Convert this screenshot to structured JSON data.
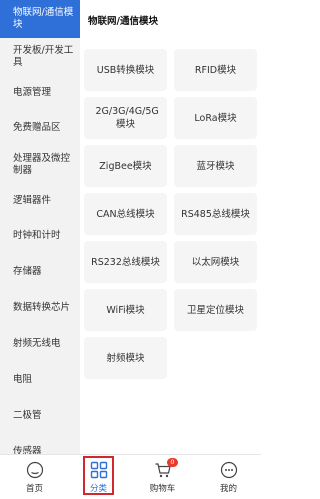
{
  "sidebar": {
    "items": [
      {
        "label": "物联网/通信模块",
        "active": true
      },
      {
        "label": "开发板/开发工具"
      },
      {
        "label": "电源管理"
      },
      {
        "label": "免费赠品区"
      },
      {
        "label": "处理器及微控制器"
      },
      {
        "label": "逻辑器件"
      },
      {
        "label": "时钟和计时"
      },
      {
        "label": "存储器"
      },
      {
        "label": "数据转换芯片"
      },
      {
        "label": "射频无线电"
      },
      {
        "label": "电阻"
      },
      {
        "label": "二极管"
      },
      {
        "label": "传感器"
      }
    ]
  },
  "content": {
    "title": "物联网/通信模块",
    "cards": [
      "USB转换模块",
      "RFID模块",
      "2G/3G/4G/5G模块",
      "LoRa模块",
      "ZigBee模块",
      "蓝牙模块",
      "CAN总线模块",
      "RS485总线模块",
      "RS232总线模块",
      "以太网模块",
      "WiFi模块",
      "卫星定位模块",
      "射频模块"
    ]
  },
  "tabbar": {
    "tabs": [
      {
        "label": "首页",
        "icon": "home-icon"
      },
      {
        "label": "分类",
        "icon": "category-grid-icon",
        "active": true
      },
      {
        "label": "购物车",
        "icon": "cart-icon",
        "badge": "0"
      },
      {
        "label": "我的",
        "icon": "profile-icon"
      }
    ]
  },
  "colors": {
    "accent": "#2e6fd8",
    "badge": "#e8392c",
    "highlight_outline": "#d0282e"
  }
}
